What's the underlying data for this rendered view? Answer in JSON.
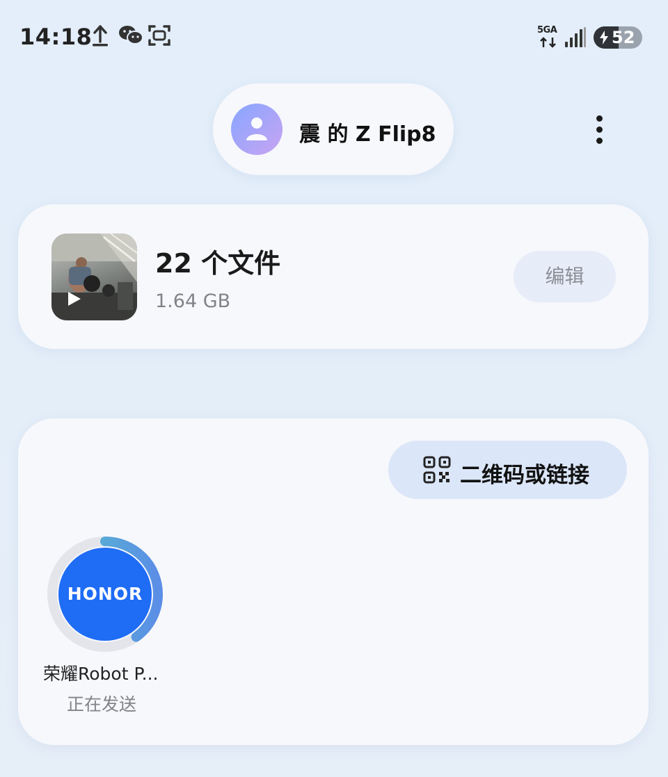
{
  "status_bar": {
    "time": "14:18",
    "network_type": "5GA",
    "battery_level": "52",
    "battery_fraction": 0.52,
    "icons": [
      "upload-icon",
      "wechat-icon",
      "screenshot-icon",
      "signal-icon",
      "charging-bolt-icon"
    ]
  },
  "header": {
    "device_name": "震 的 Z Flip8",
    "avatar_icon": "person-icon",
    "more_icon": "more-vertical-icon"
  },
  "file_card": {
    "count_label": "22 个文件",
    "size_label": "1.64 GB",
    "edit_label": "编辑",
    "thumbnail_icon": "play-icon"
  },
  "nearby": {
    "qr_label": "二维码或链接",
    "qr_icon": "qr-code-icon",
    "receivers": [
      {
        "logo_text": "HONOR",
        "name": "荣耀Robot P...",
        "status": "正在发送",
        "progress": 0.4,
        "logo_color": "#1f6cf5"
      }
    ]
  },
  "colors": {
    "background": "#e3eefa",
    "card": "#f7f8fc",
    "accent_button": "#dbe6f8",
    "progress_ring": "#5aa8e0"
  }
}
